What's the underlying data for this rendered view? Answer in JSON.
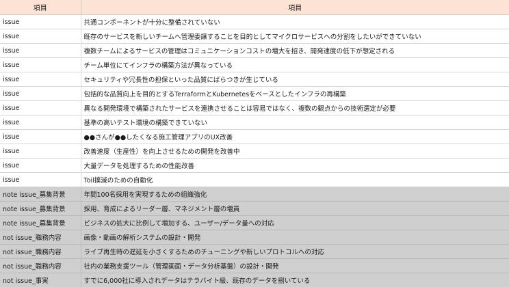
{
  "headers": [
    "項目",
    "項目"
  ],
  "rows": [
    {
      "type": "issue",
      "content": "共通コンポーネントが十分に整備されていない",
      "shade": "white"
    },
    {
      "type": "issue",
      "content": "既存のサービスを新しいチームへ管理委譲することを目的としてマイクロサービスへの分割をしたいができていない",
      "shade": "white"
    },
    {
      "type": "issue",
      "content": "複数チームによるサービスの管理はコミュニケーションコストの増大を招き、開発速度の低下が想定される",
      "shade": "white"
    },
    {
      "type": "issue",
      "content": "チーム単位にてインフラの構築方法が異なっている",
      "shade": "white"
    },
    {
      "type": "issue",
      "content": "セキュリティや冗長性の担保といった品質にばらつきが生じている",
      "shade": "white"
    },
    {
      "type": "issue",
      "content": "包括的な品質向上を目的とするTerraformとKubernetesをベースとしたインフラの再構築",
      "shade": "white"
    },
    {
      "type": "issue",
      "content": "異なる開発環境で構築されたサービスを連携させることは容易ではなく、複数の観点からの技術選定が必要",
      "shade": "white"
    },
    {
      "type": "issue",
      "content": "基準の高いテスト環境の構築できていない",
      "shade": "white"
    },
    {
      "type": "issue",
      "content": "●●さんが●●したくなる施工管理アプリのUX改善",
      "shade": "white"
    },
    {
      "type": "issue",
      "content": "改善速度（生産性）を向上させるための開発を改善中",
      "shade": "white"
    },
    {
      "type": "issue",
      "content": "大量データを処理するための性能改善",
      "shade": "white"
    },
    {
      "type": "issue",
      "content": "Toil撲滅のための自動化",
      "shade": "white"
    },
    {
      "type": "note issue_募集背景",
      "content": "年間100名採用を実現するための組織強化",
      "shade": "gray"
    },
    {
      "type": "note issue_募集背景",
      "content": "採用、育成によるリーダー層、マネジメント層の増員",
      "shade": "gray"
    },
    {
      "type": "note issue_募集背景",
      "content": "ビジネスの拡大に比例して増加する、ユーザー/データ量への対応",
      "shade": "gray"
    },
    {
      "type": "not issue_職務内容",
      "content": "画像・動画の解析システムの設計・開発",
      "shade": "gray"
    },
    {
      "type": "not issue_職務内容",
      "content": "ライブ再生時の遅延を小さくするためのチューニングや新しいプロトコルへの対応",
      "shade": "gray"
    },
    {
      "type": "not issue_職務内容",
      "content": "社内の業務支援ツール（管理画面・データ分析基盤）の設計・開発",
      "shade": "gray"
    },
    {
      "type": "not issue_事実",
      "content": "すでに6,000社に導入されデータはテラバイト級、既存のデータを捌いている",
      "shade": "gray"
    }
  ]
}
